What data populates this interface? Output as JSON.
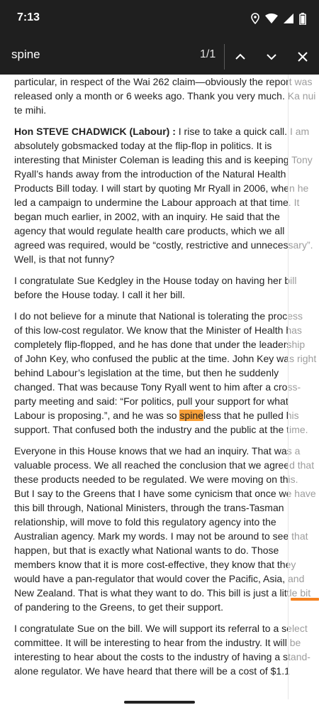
{
  "status_bar": {
    "time": "7:13",
    "icons": [
      "location-icon",
      "wifi-icon",
      "signal-icon",
      "battery-icon"
    ]
  },
  "find_bar": {
    "query": "spine",
    "match_count": "1/1",
    "buttons": [
      "previous-match",
      "next-match",
      "close"
    ]
  },
  "document": {
    "lines_p1": [
      "particular, in respect of the Wai 262 claim—obviously the report was",
      "released only a month or 6 weeks ago. Thank you very much. Ka nui",
      "te mihi."
    ],
    "p2_speaker": "Hon STEVE CHADWICK (Labour) :",
    "p2_first_line_rest": " I rise to take a quick call. I am",
    "lines_p2": [
      "absolutely gobsmacked today at the flip-flop in politics. It is",
      "interesting that Minister Coleman is leading this and is keeping Tony",
      "Ryall’s hands away from the introduction of the Natural Health",
      "Products Bill today. I will start by quoting Mr Ryall in 2006, when he",
      "led a campaign to undermine the Labour approach at that time. It",
      "began much earlier, in 2002, with an inquiry. He said that the",
      "agency that would regulate health care products, which we all",
      "agreed was required, would be “costly, restrictive and unnecessary”.",
      "Well, is that not funny?"
    ],
    "lines_p3": [
      "I congratulate Sue Kedgley in the House today on having her bill",
      "before the House today. I call it her bill."
    ],
    "lines_p4": [
      "I do not believe for a minute that National is tolerating the process",
      "of this low-cost regulator. We know that the Minister of Health has",
      "completely flip-flopped, and he has done that under the leadership",
      "of John Key, who confused the public at the time. John Key was right",
      "behind Labour’s legislation at the time, but then he suddenly",
      "changed. That was because Tony Ryall went to him after a cross-",
      "party meeting and said: “For politics, pull your support for what"
    ],
    "p4_hl_before": "Labour is proposing.”, and he was so ",
    "p4_hl_word": "spine",
    "p4_hl_after": "less that he pulled his",
    "p4_last": "support. That confused both the industry and the public at the time.",
    "lines_p5": [
      "Everyone in this House knows that we had an inquiry. That was a",
      "valuable process. We all reached the conclusion that we agreed that",
      "these products needed to be regulated. We were moving on this.",
      "But I say to the Greens that I have some cynicism that once we have",
      "this bill through, National Ministers, through the trans-Tasman",
      "relationship, will move to fold this regulatory agency into the",
      "Australian agency. Mark my words. I may not be around to see that",
      "happen, but that is exactly what National wants to do. Those",
      "members know that it is more cost-effective, they know that they",
      "would have a pan-regulator that would cover the Pacific, Asia, and",
      "New Zealand. That is what they want to do. This bill is just a little bit",
      "of pandering to the Greens, to get their support."
    ],
    "lines_p6": [
      "I congratulate Sue on the bill. We will support its referral to a select",
      "committee. It will be interesting to hear from the industry. It will be",
      "interesting to hear about the costs to the industry of having a stand-",
      "alone regulator. We have heard that there will be a cost of $1.1"
    ]
  },
  "colors": {
    "bar_background": "#1f1f1f",
    "highlight": "#f9a13a",
    "scroll_marker": "#f58220"
  }
}
